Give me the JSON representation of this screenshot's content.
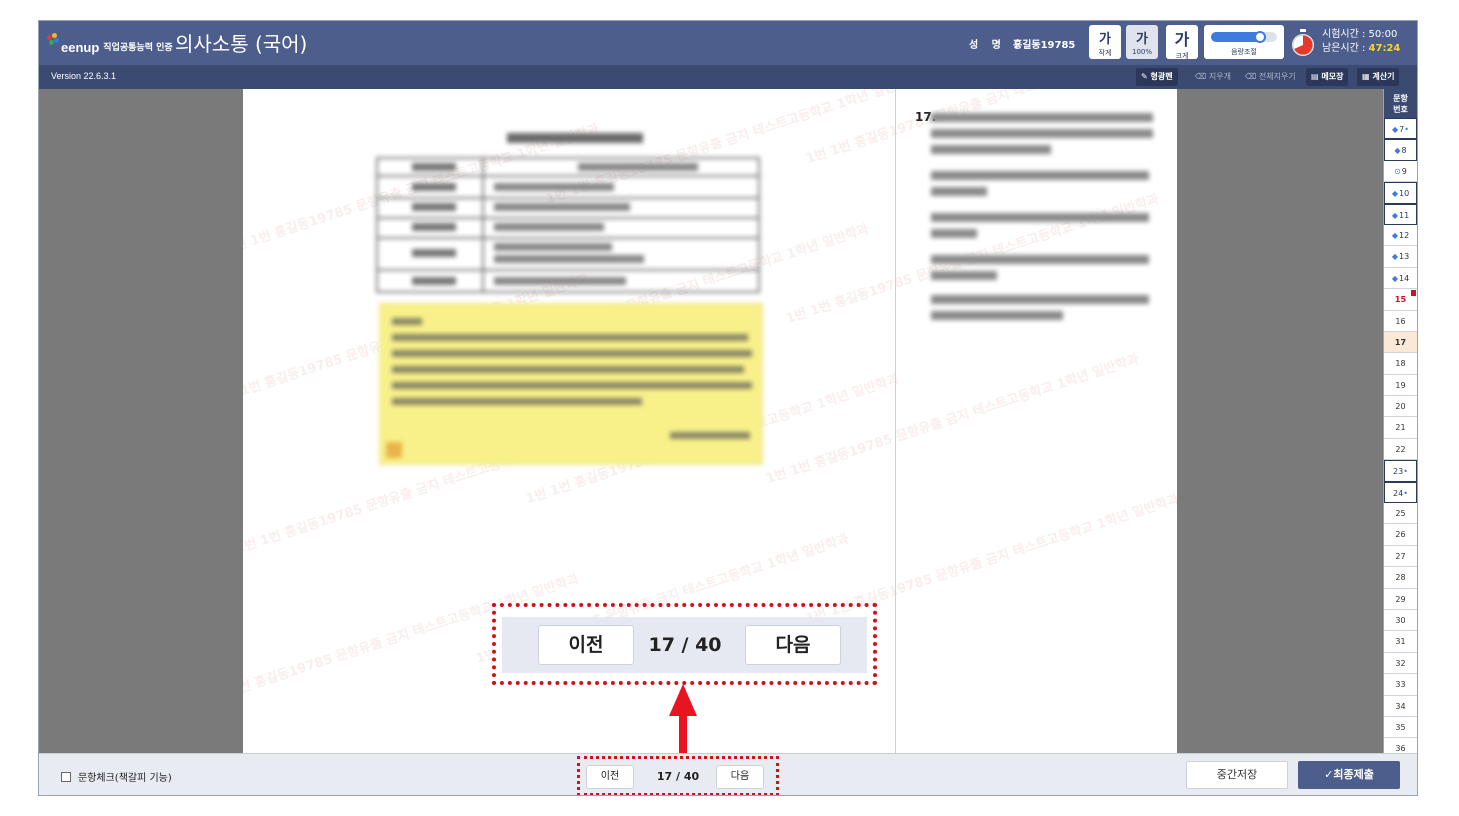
{
  "header": {
    "brand": "eenup",
    "brand_sub": "직업공통능력 인증",
    "title": "의사소통 (국어)",
    "name_label": "성 명 :",
    "name_value": "홍길동19785",
    "font_buttons": [
      {
        "glyph": "가",
        "label": "작게"
      },
      {
        "glyph": "가",
        "label": "100%"
      },
      {
        "glyph": "가",
        "label": "크게"
      }
    ],
    "volume": {
      "label": "음량조절",
      "level": 0.8
    },
    "timer": {
      "total_label": "시험시간 : 50:00",
      "remaining_prefix": "남은시간 : ",
      "remaining_value": "47:24"
    }
  },
  "toolbar": {
    "version": "Version 22.6.3.1",
    "highlighter": "✎ 형광펜",
    "eraser": "⌫ 지우개",
    "erase_all": "⌫ 전체지우기",
    "memo": "▤ 메모장",
    "calculator": "▦ 계산기"
  },
  "question": {
    "number": "17.",
    "current": 17,
    "total": 40,
    "counter": "17 / 40"
  },
  "watermark": "1번 1번 홍길동19785 문항유출 금지 테스트고등학교 1학년 일반학과",
  "nav": {
    "prev": "이전",
    "next": "다음"
  },
  "rail": {
    "header": "문항\n번호",
    "items": [
      {
        "n": "7",
        "state": "answered",
        "mark": "◆",
        "dot": "•"
      },
      {
        "n": "8",
        "state": "answered",
        "mark": "◆",
        "dot": ""
      },
      {
        "n": "9",
        "state": "normal",
        "mark": "⊙",
        "dot": ""
      },
      {
        "n": "10",
        "state": "answered",
        "mark": "◆",
        "dot": ""
      },
      {
        "n": "11",
        "state": "answered",
        "mark": "◆",
        "dot": ""
      },
      {
        "n": "12",
        "state": "normal",
        "mark": "◆",
        "dot": ""
      },
      {
        "n": "13",
        "state": "normal",
        "mark": "◆",
        "dot": ""
      },
      {
        "n": "14",
        "state": "normal",
        "mark": "◆",
        "dot": ""
      },
      {
        "n": "15",
        "state": "flagged",
        "mark": "",
        "dot": ""
      },
      {
        "n": "16",
        "state": "normal",
        "mark": "",
        "dot": ""
      },
      {
        "n": "17",
        "state": "current",
        "mark": "",
        "dot": ""
      },
      {
        "n": "18",
        "state": "normal",
        "mark": "",
        "dot": ""
      },
      {
        "n": "19",
        "state": "normal",
        "mark": "",
        "dot": ""
      },
      {
        "n": "20",
        "state": "normal",
        "mark": "",
        "dot": ""
      },
      {
        "n": "21",
        "state": "normal",
        "mark": "",
        "dot": ""
      },
      {
        "n": "22",
        "state": "normal",
        "mark": "",
        "dot": ""
      },
      {
        "n": "23",
        "state": "answered",
        "mark": "",
        "dot": "•"
      },
      {
        "n": "24",
        "state": "answered",
        "mark": "",
        "dot": "•"
      },
      {
        "n": "25",
        "state": "normal",
        "mark": "",
        "dot": ""
      },
      {
        "n": "26",
        "state": "normal",
        "mark": "",
        "dot": ""
      },
      {
        "n": "27",
        "state": "normal",
        "mark": "",
        "dot": ""
      },
      {
        "n": "28",
        "state": "normal",
        "mark": "",
        "dot": ""
      },
      {
        "n": "29",
        "state": "normal",
        "mark": "",
        "dot": ""
      },
      {
        "n": "30",
        "state": "normal",
        "mark": "",
        "dot": ""
      },
      {
        "n": "31",
        "state": "normal",
        "mark": "",
        "dot": ""
      },
      {
        "n": "32",
        "state": "normal",
        "mark": "",
        "dot": ""
      },
      {
        "n": "33",
        "state": "normal",
        "mark": "",
        "dot": ""
      },
      {
        "n": "34",
        "state": "normal",
        "mark": "",
        "dot": ""
      },
      {
        "n": "35",
        "state": "normal",
        "mark": "",
        "dot": ""
      },
      {
        "n": "36",
        "state": "normal",
        "mark": "",
        "dot": ""
      }
    ]
  },
  "footer": {
    "bookmark_label": "문항체크(책갈피 기능)",
    "save": "중간저장",
    "submit": "✓최종제출"
  },
  "colors": {
    "header": "#4d5e8c",
    "subheader": "#3b4a71",
    "accent_red": "#d0121b",
    "timer_remaining": "#ffd233"
  }
}
